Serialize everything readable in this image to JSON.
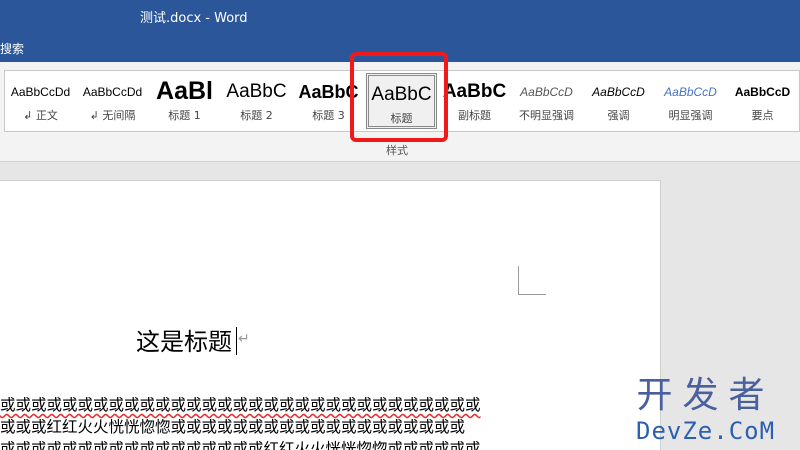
{
  "window": {
    "title": "测试.docx  -  Word"
  },
  "tell_me": {
    "label": "搜索"
  },
  "styles_gallery": {
    "group_label": "样式",
    "items": [
      {
        "sample": "AaBbCcDd",
        "name": "↲ 正文"
      },
      {
        "sample": "AaBbCcDd",
        "name": "↲ 无间隔"
      },
      {
        "sample": "AaBl",
        "name": "标题 1"
      },
      {
        "sample": "AaBbC",
        "name": "标题 2"
      },
      {
        "sample": "AaBbC",
        "name": "标题 3"
      },
      {
        "sample": "AaBbC",
        "name": "标题",
        "selected": true
      },
      {
        "sample": "AaBbC",
        "name": "副标题"
      },
      {
        "sample": "AaBbCcD",
        "name": "不明显强调"
      },
      {
        "sample": "AaBbCcD",
        "name": "强调"
      },
      {
        "sample": "AaBbCcD",
        "name": "明显强调"
      },
      {
        "sample": "AaBbCcD",
        "name": "要点"
      }
    ]
  },
  "document": {
    "heading": "这是标题",
    "pilcrow": "↵",
    "lines": [
      "或或或或或或或或或或或或或或或或或或或或或或或或或或或或或或或",
      "或或或红红火火恍恍惚惚或或或或或或或或或或或或或或或或或或或",
      "或或或或或或或或或或或或或或或或或红红火火恍恍惚惚或或或或或或"
    ]
  },
  "watermark": {
    "cn": "开发者",
    "en": "DevZe.CoM"
  },
  "colors": {
    "title_bar": "#2b579a",
    "highlight_box": "#f01a1a",
    "spell_check": "#e03030"
  }
}
